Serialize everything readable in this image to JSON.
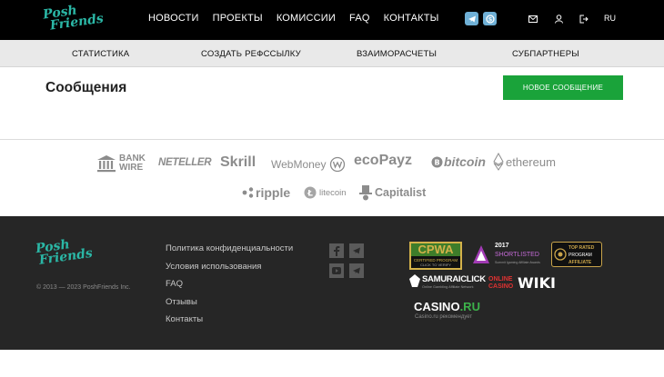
{
  "header": {
    "logo_line1": "Posh",
    "logo_line2": "Friends",
    "nav": [
      "НОВОСТИ",
      "ПРОЕКТЫ",
      "КОМИССИИ",
      "FAQ",
      "КОНТАКТЫ"
    ],
    "lang": "RU",
    "icons": [
      "telegram-icon",
      "skype-icon",
      "mail-icon",
      "user-icon",
      "logout-icon"
    ]
  },
  "subnav": [
    "СТАТИСТИКА",
    "СОЗДАТЬ РЕФССЫЛКУ",
    "ВЗАИМОРАСЧЕТЫ",
    "СУБПАРТНЕРЫ"
  ],
  "main": {
    "title": "Сообщения",
    "new_message_button": "НОВОЕ СООБЩЕНИЕ"
  },
  "payments": {
    "bank_wire_1": "BANK",
    "bank_wire_2": "WIRE",
    "neteller": "NETELLER",
    "skrill": "Skrill",
    "webmoney": "WebMoney",
    "ecopayz": "ecoPayz",
    "bitcoin": "bitcoin",
    "ethereum": "ethereum",
    "ripple": "ripple",
    "litecoin": "litecoin",
    "capitalist": "Capitalist"
  },
  "footer": {
    "logo_line1": "Posh",
    "logo_line2": "Friends",
    "copyright": "© 2013 — 2023 PoshFriends Inc.",
    "links": [
      "Политика конфиденциальности",
      "Условия использования",
      "FAQ",
      "Отзывы",
      "Контакты"
    ],
    "social_icons": [
      "facebook-icon",
      "telegram-icon",
      "youtube-icon",
      "telegram-icon"
    ],
    "badges": {
      "cpwa_main": "CPWA",
      "cpwa_sub": "CERTIFIED PROGRAM",
      "cpwa_sub2": "CLICK TO VERIFY",
      "award_year": "2017",
      "award_status": "SHORTLISTED",
      "award_note": "Summit Igaming Affiliate Awards",
      "top_program_1": "TOP RATED",
      "top_program_2": "PROGRAM",
      "top_program_3": "AFFILIATE",
      "samurai": "SAMURAICLICK",
      "samurai_sub": "Online Gambling Affiliate Network",
      "online_casino_1": "ONLINE",
      "online_casino_2": "CASINO",
      "wiki": "WIKI",
      "casino_ru_1": "CASINO",
      "casino_ru_2": ".RU",
      "casino_ru_sub": "Casino.ru рекомендует"
    }
  },
  "colors": {
    "accent": "#2bb7a6",
    "button": "#1aa33a",
    "header_bg": "#000000",
    "footer_bg": "#262626"
  }
}
